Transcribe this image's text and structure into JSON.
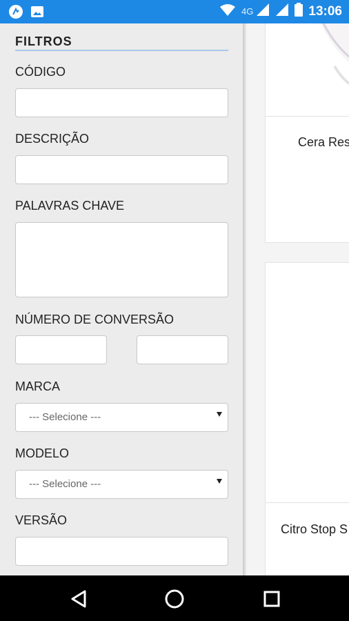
{
  "status_bar": {
    "network": "4G",
    "time": "13:06",
    "icons": [
      "app-notification-icon",
      "image-icon",
      "wifi-icon",
      "signal-4g-icon",
      "signal-icon",
      "battery-icon"
    ]
  },
  "drawer": {
    "title": "FILTROS",
    "fields": {
      "codigo": {
        "label": "CÓDIGO",
        "value": ""
      },
      "descricao": {
        "label": "DESCRIÇÃO",
        "value": ""
      },
      "palavras_chave": {
        "label": "PALAVRAS CHAVE",
        "value": ""
      },
      "numero_conversao": {
        "label": "NÚMERO DE CONVERSÃO",
        "from": "",
        "to": ""
      },
      "marca": {
        "label": "MARCA",
        "selected": "--- Selecione ---"
      },
      "modelo": {
        "label": "MODELO",
        "selected": "--- Selecione ---"
      },
      "versao": {
        "label": "VERSÃO",
        "value": ""
      }
    }
  },
  "products": [
    {
      "title": "Cera Res"
    },
    {
      "title": "Citro Stop S"
    }
  ],
  "nav_bar": {
    "icons": [
      "back-icon",
      "home-icon",
      "recents-icon"
    ]
  },
  "colors": {
    "status_bar": "#1e88e5",
    "drawer_bg": "#ececec",
    "accent_underline": "#a9c8ea"
  }
}
